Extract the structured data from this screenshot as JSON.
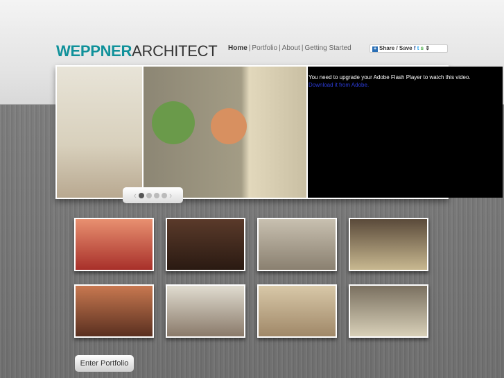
{
  "logo": {
    "part1": "WEPPNER",
    "part2": "ARCHITECT"
  },
  "nav": [
    {
      "label": "Home"
    },
    {
      "label": "Portfolio"
    },
    {
      "label": "About"
    },
    {
      "label": "Getting Started"
    }
  ],
  "share": {
    "label": "Share / Save"
  },
  "flash": {
    "message": "You need to upgrade your Adobe Flash Player to watch this video.",
    "link": "Download it from Adobe."
  },
  "slider": {
    "dots": 4,
    "active": 0
  },
  "thumbnails": [
    {
      "colors": [
        "#e89070",
        "#a8302a"
      ]
    },
    {
      "colors": [
        "#5a3a2a",
        "#2a1a12"
      ]
    },
    {
      "colors": [
        "#c8c0b0",
        "#8a8070"
      ]
    },
    {
      "colors": [
        "#5a4a3a",
        "#c8b890"
      ]
    },
    {
      "colors": [
        "#c87850",
        "#5a3020"
      ]
    },
    {
      "colors": [
        "#e0dcd0",
        "#8a7a6a"
      ]
    },
    {
      "colors": [
        "#d8c8a8",
        "#a08868"
      ]
    },
    {
      "colors": [
        "#7a7060",
        "#d8d0b8"
      ]
    }
  ],
  "enter_button": {
    "label": "Enter Portfolio"
  }
}
